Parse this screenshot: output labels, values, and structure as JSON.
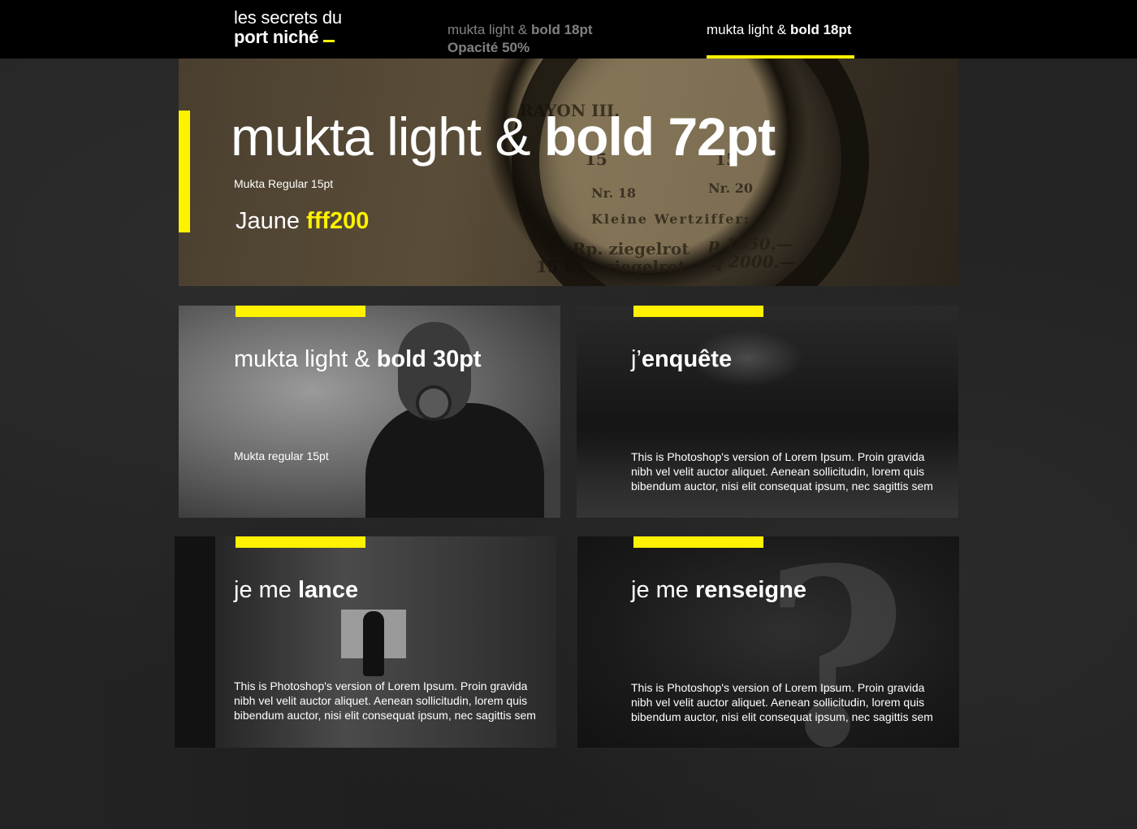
{
  "colors": {
    "accent": "#fff200",
    "background": "#232323",
    "topbar": "#000000",
    "text": "#ffffff"
  },
  "brand": {
    "line1": "les secrets du",
    "line2": "port niché"
  },
  "nav": {
    "dim": {
      "light": "mukta light & ",
      "bold": "bold 18pt",
      "sub": "Opacité 50%"
    },
    "active": {
      "light": "mukta light & ",
      "bold": "bold 18pt"
    }
  },
  "hero": {
    "title_light": "mukta light & ",
    "title_bold": "bold 72pt",
    "subtitle": "Mukta Regular 15pt",
    "color_label": "Jaune ",
    "color_value": "fff200",
    "image_text": {
      "line1": "RAYON III.",
      "num1": "15",
      "num2": "15",
      "nr1": "Nr. 18",
      "nr2": "Nr. 20",
      "kleine": "Kleine Wertziffer:",
      "row1a": "15 Rp. ziegelrot",
      "row1b": "p 1350.—",
      "row2a": "15 Cts. ziegelrot",
      "row2b": "q 2000.—"
    }
  },
  "cards": [
    {
      "title_light": "mukta light & ",
      "title_bold": "bold 30pt",
      "body": "Mukta regular 15pt"
    },
    {
      "title_light": "j’",
      "title_bold": "enquête",
      "body": "This is Photoshop's version  of Lorem Ipsum. Proin gravida nibh vel velit auctor aliquet. Aenean sollicitudin, lorem quis bibendum auctor, nisi elit consequat ipsum, nec sagittis sem"
    },
    {
      "title_light": "je me ",
      "title_bold": "lance",
      "body": "This is Photoshop's version  of Lorem Ipsum. Proin gravida nibh vel velit auctor aliquet. Aenean sollicitudin, lorem quis bibendum auctor, nisi elit consequat ipsum, nec sagittis sem"
    },
    {
      "title_light": "je me ",
      "title_bold": "renseigne",
      "body": "This is Photoshop's version  of Lorem Ipsum. Proin gravida nibh vel velit auctor aliquet. Aenean sollicitudin, lorem quis bibendum auctor, nisi elit consequat ipsum, nec sagittis sem"
    }
  ]
}
